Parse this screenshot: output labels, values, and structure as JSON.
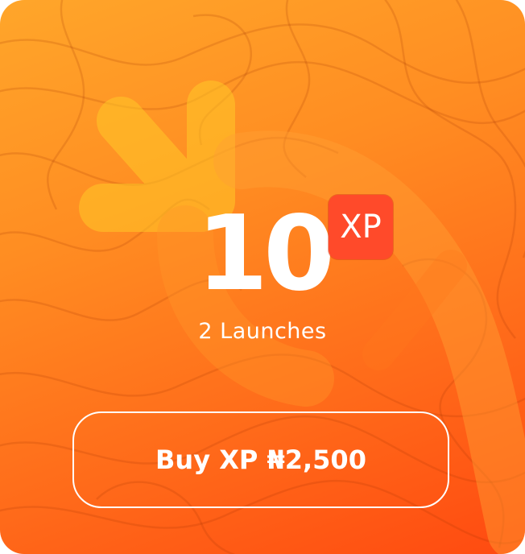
{
  "offer": {
    "amount": "10",
    "unit_badge": "XP",
    "subtitle": "2 Launches",
    "buy_label": "Buy XP ₦2,500"
  },
  "colors": {
    "gradient_start": "#ffa62a",
    "gradient_end": "#ff4a10",
    "badge": "#ff4a2a",
    "text": "#ffffff"
  },
  "icons": [
    "topographic-pattern",
    "brand-logo-watermark"
  ]
}
